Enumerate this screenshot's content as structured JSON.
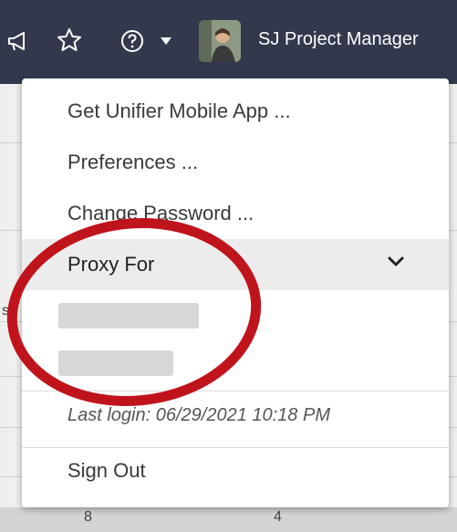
{
  "header": {
    "user_name": "SJ Project Manager",
    "icons": [
      "megaphone-icon",
      "star-icon",
      "help-icon",
      "caret-down-icon",
      "avatar"
    ]
  },
  "menu": {
    "items": [
      {
        "label": "Get Unifier Mobile App ..."
      },
      {
        "label": "Preferences ..."
      },
      {
        "label": "Change Password ..."
      }
    ],
    "proxy": {
      "label": "Proxy For",
      "expanded": true
    },
    "last_login": "Last login: 06/29/2021 10:18 PM",
    "sign_out": "Sign Out"
  },
  "background": {
    "bottom_values": [
      "8",
      "4"
    ],
    "side_letter": "s"
  },
  "colors": {
    "header_bg": "#32394d",
    "menu_bg": "#ffffff",
    "proxy_bg": "#ececec",
    "annotation": "#c0141c"
  }
}
